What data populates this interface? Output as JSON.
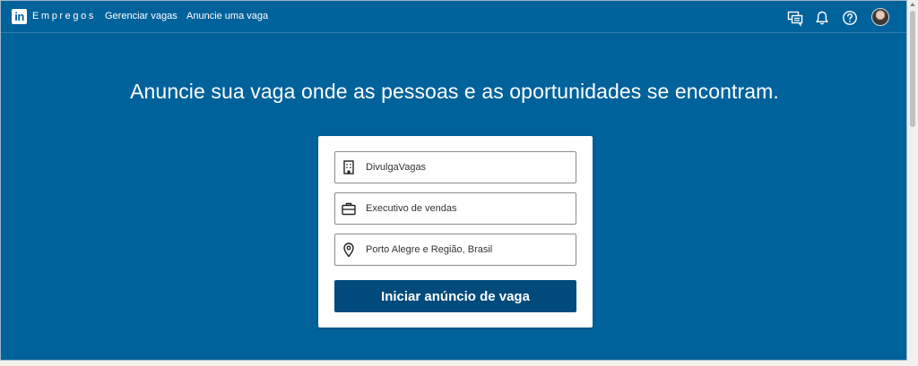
{
  "header": {
    "logo_text": "in",
    "brand": "Empregos",
    "nav": [
      {
        "label": "Gerenciar vagas"
      },
      {
        "label": "Anuncie uma vaga"
      }
    ],
    "icons": [
      "messages-icon",
      "notifications-bell-icon",
      "help-icon",
      "avatar"
    ]
  },
  "hero": {
    "headline": "Anuncie sua vaga onde as pessoas e as oportunidades se encontram."
  },
  "form": {
    "company": {
      "icon": "building-icon",
      "value": "DivulgaVagas"
    },
    "job_title": {
      "icon": "briefcase-icon",
      "value": "Executivo de vendas"
    },
    "location": {
      "icon": "location-pin-icon",
      "value": "Porto Alegre e Região, Brasil"
    },
    "submit_label": "Iniciar anúncio de vaga"
  },
  "colors": {
    "background": "#00629b",
    "button": "#004b7c",
    "card": "#ffffff"
  }
}
